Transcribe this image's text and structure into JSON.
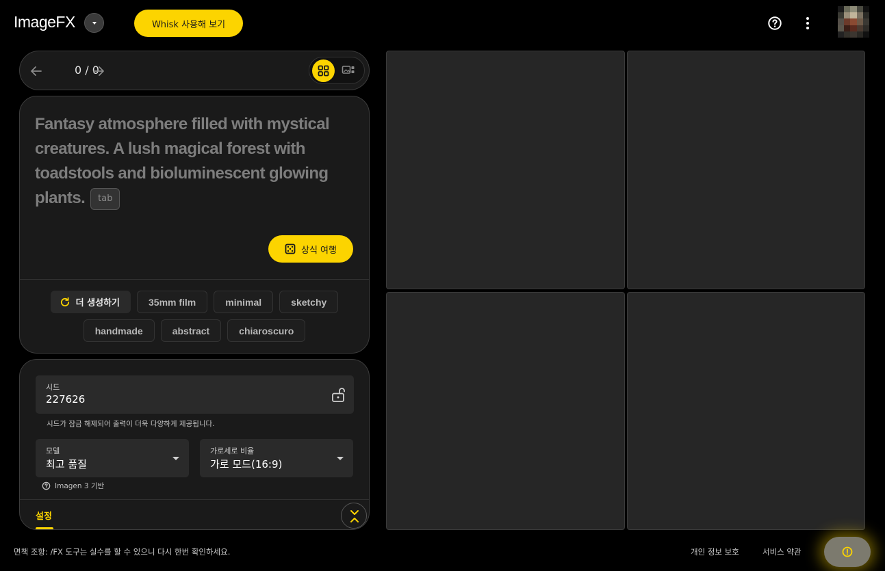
{
  "header": {
    "logo": "ImageFX",
    "whisk_button": "Whisk 사용해 보기",
    "help_icon": "help-circle-icon",
    "more_icon": "more-vert-icon"
  },
  "navigator": {
    "count": "0 / 0",
    "prev_icon": "arrow-left-icon",
    "next_icon": "arrow-right-icon",
    "view_modes": [
      "grid-view-icon",
      "single-view-icon"
    ],
    "active_view": "grid"
  },
  "prompt": {
    "text": "Fantasy atmosphere filled with mystical creatures. A lush magical forest with toadstools and bioluminescent glowing plants.",
    "tab_hint": "tab",
    "lucky_button": "상식 여행"
  },
  "chips": {
    "more_label": "더 생성하기",
    "row1": [
      "35mm film",
      "minimal",
      "sketchy"
    ],
    "row2": [
      "handmade",
      "abstract",
      "chiaroscuro"
    ]
  },
  "settings": {
    "seed_label": "시드",
    "seed_value": "227626",
    "seed_note": "시드가 잠금 해제되어 출력이 더욱 다양하게 제공됩니다.",
    "model_label": "모델",
    "model_value": "최고 품질",
    "ratio_label": "가로세로 비율",
    "ratio_value": "가로 모드(16:9)",
    "imagen_note": "Imagen 3 기반",
    "tab_label": "설정"
  },
  "footer": {
    "disclaimer": "면책 조항: /FX 도구는 실수를 할 수 있으니 다시 한번 확인하세요.",
    "privacy": "개인 정보 보호",
    "terms": "서비스 약관"
  },
  "colors": {
    "accent": "#fcd400",
    "background": "#000000",
    "panel": "#1a1a1a",
    "image_placeholder": "#262626"
  }
}
